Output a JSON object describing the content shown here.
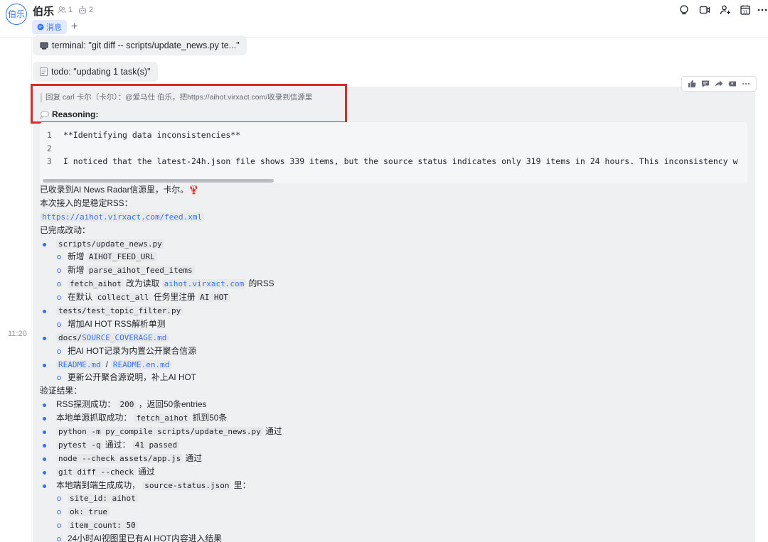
{
  "header": {
    "avatar_text": "伯乐",
    "title": "伯乐",
    "members_count": "1",
    "bots_count": "2",
    "tab_message": "消息",
    "tab_add": "+"
  },
  "messages": {
    "terminal": "terminal: \"git diff -- scripts/update_news.py te...\"",
    "todo": "todo: \"updating 1 task(s)\"",
    "timestamp": "11:20",
    "reply_quote": "回复 carl 卡尔（卡尔）：@爱马仕 伯乐，把https://aihot.virxact.com/收录到信源里",
    "reasoning_label": "Reasoning:",
    "code": [
      {
        "n": "1",
        "text": "**Identifying data inconsistencies**"
      },
      {
        "n": "2",
        "text": ""
      },
      {
        "n": "3",
        "text": "I noticed that the latest-24h.json file shows 339 items, but the source status indicates only 319 items in 24 hours. This inconsistency w"
      }
    ]
  },
  "body": {
    "line_intro": "已收录到AI News Radar信源里，卡尔。🦞",
    "line_rss": "本次接入的是稳定RSS：",
    "rss_url": "https://aihot.virxact.com/feed.xml",
    "line_done": "已完成改动：",
    "f1": "scripts/update_news.py",
    "f1a_pre": "新增",
    "f1a_code": "AIHOT_FEED_URL",
    "f1b_pre": "新增",
    "f1b_code": "parse_aihot_feed_items",
    "f1c_code": "fetch_aihot",
    "f1c_mid": "改为读取",
    "f1c_link": "aihot.virxact.com",
    "f1c_post": "的RSS",
    "f1d_pre": "在默认",
    "f1d_code": "collect_all",
    "f1d_mid": "任务里注册",
    "f1d_code2": "AI HOT",
    "f2": "tests/test_topic_filter.py",
    "f2a": "增加AI HOT RSS解析单测",
    "f3_pre": "docs/",
    "f3_link": "SOURCE_COVERAGE.md",
    "f3a": "把AI HOT记录为内置公开聚合信源",
    "f4_link1": "README.md",
    "f4_sep": "/",
    "f4_link2": "README.en.md",
    "f4a": "更新公开聚合源说明，补上AI HOT",
    "line_verify": "验证结果：",
    "v1_pre": "RSS探测成功：",
    "v1_code": "200",
    "v1_post": "，返回50条entries",
    "v2_pre": "本地单源抓取成功：",
    "v2_code": "fetch_aihot",
    "v2_post": "抓到50条",
    "v3_code": "python -m py_compile scripts/update_news.py",
    "v3_post": "通过",
    "v4_code": "pytest -q",
    "v4_mid": "通过：",
    "v4_code2": "41 passed",
    "v5_code": "node --check assets/app.js",
    "v5_post": "通过",
    "v6_code": "git diff --check",
    "v6_post": "通过",
    "v7_pre": "本地端到端生成成功，",
    "v7_code": "source-status.json",
    "v7_post": "里：",
    "v7a": "site_id: aihot",
    "v7b": "ok: true",
    "v7c": "item_count: 50",
    "v7d": "24小时AI视图里已有AI HOT内容进入结果"
  }
}
